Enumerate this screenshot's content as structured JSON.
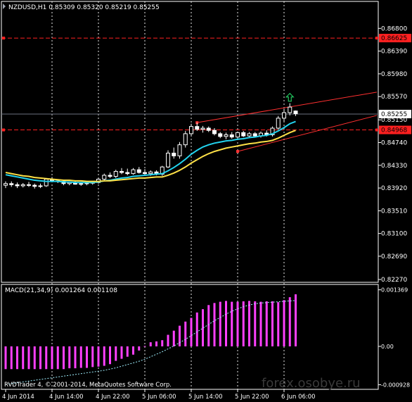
{
  "header": {
    "text": "NZDUSD,H1  0.85309 0.85320 0.85219 0.85255"
  },
  "macd_header": {
    "text": "MACD(21,34,9) 0.001264 0.001108"
  },
  "copyright": "RVDTrader 4, © 2001-2014, MetaQuotes Software Corp.",
  "watermark": "forex.osobye.ru",
  "colors": {
    "background": "#000000",
    "grid": "#ffffff",
    "axis": "#ffffff",
    "bull_candle": "#ffffff",
    "bear_candle": "#ffffff",
    "ma_fast": "#22d3ee",
    "ma_slow": "#fde047",
    "hline": "#ff2020",
    "channel": "#ff3030",
    "price_label_bg": "#ff2020",
    "current_label_bg": "#ffffff",
    "macd_hist": "#ff40ff",
    "macd_signal": "#a0f0ff",
    "arrow": "#22c55e"
  },
  "chart_data": [
    {
      "type": "line",
      "pane": "price",
      "title": "NZDUSD,H1",
      "ylim": [
        0.8227,
        0.8688
      ],
      "y_ticks": [
        "0.86800",
        "0.86390",
        "0.85980",
        "0.85570",
        "0.85150",
        "0.84740",
        "0.84330",
        "0.83920",
        "0.83510",
        "0.83100",
        "0.82690",
        "0.82270"
      ],
      "y_tick_values": [
        0.868,
        0.8639,
        0.8598,
        0.8557,
        0.8515,
        0.8474,
        0.8433,
        0.8392,
        0.8351,
        0.831,
        0.8269,
        0.8227
      ],
      "x_ticks": [
        "4 Jun 2014",
        "4 Jun 14:00",
        "4 Jun 22:00",
        "5 Jun 06:00",
        "5 Jun 14:00",
        "5 Jun 22:00",
        "6 Jun 06:00"
      ],
      "x_tick_bars": [
        0,
        8,
        16,
        24,
        32,
        40,
        48
      ],
      "candles": [
        {
          "o": 0.8397,
          "h": 0.8404,
          "l": 0.8392,
          "c": 0.84
        },
        {
          "o": 0.84,
          "h": 0.8404,
          "l": 0.8394,
          "c": 0.8398
        },
        {
          "o": 0.8398,
          "h": 0.8402,
          "l": 0.8392,
          "c": 0.8396
        },
        {
          "o": 0.8396,
          "h": 0.8401,
          "l": 0.8393,
          "c": 0.8398
        },
        {
          "o": 0.8398,
          "h": 0.8403,
          "l": 0.8394,
          "c": 0.8397
        },
        {
          "o": 0.8397,
          "h": 0.84,
          "l": 0.8391,
          "c": 0.8395
        },
        {
          "o": 0.8395,
          "h": 0.84,
          "l": 0.8392,
          "c": 0.8396
        },
        {
          "o": 0.8396,
          "h": 0.841,
          "l": 0.8394,
          "c": 0.8408
        },
        {
          "o": 0.8408,
          "h": 0.8412,
          "l": 0.8403,
          "c": 0.8405
        },
        {
          "o": 0.8405,
          "h": 0.8408,
          "l": 0.8401,
          "c": 0.8404
        },
        {
          "o": 0.8404,
          "h": 0.8407,
          "l": 0.8397,
          "c": 0.84
        },
        {
          "o": 0.84,
          "h": 0.8404,
          "l": 0.8397,
          "c": 0.8402
        },
        {
          "o": 0.8402,
          "h": 0.8405,
          "l": 0.8398,
          "c": 0.8399
        },
        {
          "o": 0.8399,
          "h": 0.8402,
          "l": 0.8396,
          "c": 0.84
        },
        {
          "o": 0.84,
          "h": 0.8403,
          "l": 0.8397,
          "c": 0.8401
        },
        {
          "o": 0.8401,
          "h": 0.8404,
          "l": 0.8398,
          "c": 0.8402
        },
        {
          "o": 0.8402,
          "h": 0.841,
          "l": 0.84,
          "c": 0.8408
        },
        {
          "o": 0.8408,
          "h": 0.8418,
          "l": 0.8405,
          "c": 0.8415
        },
        {
          "o": 0.8415,
          "h": 0.842,
          "l": 0.841,
          "c": 0.8413
        },
        {
          "o": 0.8413,
          "h": 0.8425,
          "l": 0.841,
          "c": 0.8422
        },
        {
          "o": 0.8422,
          "h": 0.8428,
          "l": 0.8417,
          "c": 0.842
        },
        {
          "o": 0.842,
          "h": 0.8427,
          "l": 0.8415,
          "c": 0.8418
        },
        {
          "o": 0.8418,
          "h": 0.8428,
          "l": 0.8416,
          "c": 0.8425
        },
        {
          "o": 0.8425,
          "h": 0.843,
          "l": 0.8418,
          "c": 0.842
        },
        {
          "o": 0.842,
          "h": 0.8426,
          "l": 0.8415,
          "c": 0.8418
        },
        {
          "o": 0.8418,
          "h": 0.8424,
          "l": 0.8414,
          "c": 0.8421
        },
        {
          "o": 0.8421,
          "h": 0.8424,
          "l": 0.8415,
          "c": 0.8417
        },
        {
          "o": 0.8417,
          "h": 0.8432,
          "l": 0.8414,
          "c": 0.843
        },
        {
          "o": 0.843,
          "h": 0.846,
          "l": 0.8428,
          "c": 0.8455
        },
        {
          "o": 0.8455,
          "h": 0.8465,
          "l": 0.8445,
          "c": 0.845
        },
        {
          "o": 0.845,
          "h": 0.8475,
          "l": 0.8445,
          "c": 0.847
        },
        {
          "o": 0.847,
          "h": 0.8495,
          "l": 0.8465,
          "c": 0.849
        },
        {
          "o": 0.849,
          "h": 0.8508,
          "l": 0.8485,
          "c": 0.8503
        },
        {
          "o": 0.8503,
          "h": 0.851,
          "l": 0.8495,
          "c": 0.8498
        },
        {
          "o": 0.8498,
          "h": 0.8504,
          "l": 0.8492,
          "c": 0.85
        },
        {
          "o": 0.85,
          "h": 0.8503,
          "l": 0.8493,
          "c": 0.8496
        },
        {
          "o": 0.8496,
          "h": 0.85,
          "l": 0.8487,
          "c": 0.849
        },
        {
          "o": 0.849,
          "h": 0.8493,
          "l": 0.8482,
          "c": 0.8485
        },
        {
          "o": 0.8485,
          "h": 0.8492,
          "l": 0.848,
          "c": 0.8488
        },
        {
          "o": 0.8488,
          "h": 0.8493,
          "l": 0.8481,
          "c": 0.8484
        },
        {
          "o": 0.8484,
          "h": 0.8494,
          "l": 0.8481,
          "c": 0.8492
        },
        {
          "o": 0.8492,
          "h": 0.8495,
          "l": 0.8484,
          "c": 0.8486
        },
        {
          "o": 0.8486,
          "h": 0.8493,
          "l": 0.8482,
          "c": 0.849
        },
        {
          "o": 0.849,
          "h": 0.8493,
          "l": 0.8483,
          "c": 0.8486
        },
        {
          "o": 0.8486,
          "h": 0.8494,
          "l": 0.8483,
          "c": 0.8491
        },
        {
          "o": 0.8491,
          "h": 0.8496,
          "l": 0.8485,
          "c": 0.8488
        },
        {
          "o": 0.8488,
          "h": 0.8503,
          "l": 0.8485,
          "c": 0.85
        },
        {
          "o": 0.85,
          "h": 0.8522,
          "l": 0.8497,
          "c": 0.8518
        },
        {
          "o": 0.8518,
          "h": 0.8535,
          "l": 0.8512,
          "c": 0.8528
        },
        {
          "o": 0.8528,
          "h": 0.8545,
          "l": 0.8523,
          "c": 0.8538
        },
        {
          "o": 0.8531,
          "h": 0.8532,
          "l": 0.8522,
          "c": 0.8526
        }
      ],
      "series": [
        {
          "values": [
            0.8416,
            0.8414,
            0.8412,
            0.841,
            0.8408,
            0.8406,
            0.8405,
            0.8404,
            0.8404,
            0.8404,
            0.8403,
            0.8403,
            0.8402,
            0.8402,
            0.8402,
            0.8402,
            0.8403,
            0.8405,
            0.8406,
            0.8408,
            0.841,
            0.8411,
            0.8413,
            0.8414,
            0.8415,
            0.8416,
            0.8417,
            0.8418,
            0.8423,
            0.8429,
            0.8436,
            0.8444,
            0.8453,
            0.846,
            0.8466,
            0.847,
            0.8473,
            0.8475,
            0.8477,
            0.8478,
            0.848,
            0.8481,
            0.8483,
            0.8484,
            0.8486,
            0.8487,
            0.849,
            0.8495,
            0.8501,
            0.8508,
            0.8512
          ]
        },
        {
          "values": [
            0.842,
            0.8418,
            0.8416,
            0.8414,
            0.8413,
            0.8411,
            0.841,
            0.8409,
            0.8408,
            0.8407,
            0.8406,
            0.8406,
            0.8405,
            0.8405,
            0.8404,
            0.8404,
            0.8404,
            0.8405,
            0.8405,
            0.8406,
            0.8407,
            0.8408,
            0.8409,
            0.841,
            0.841,
            0.8411,
            0.8412,
            0.8412,
            0.8415,
            0.8419,
            0.8424,
            0.843,
            0.8437,
            0.8443,
            0.8449,
            0.8454,
            0.8458,
            0.8461,
            0.8464,
            0.8466,
            0.8468,
            0.847,
            0.8472,
            0.8473,
            0.8475,
            0.8476,
            0.8478,
            0.8482,
            0.8487,
            0.8492,
            0.8496
          ]
        }
      ],
      "hlines": [
        {
          "value": 0.86625,
          "label": "0.86625"
        },
        {
          "value": 0.84968,
          "label": "0.84968"
        }
      ],
      "current_price": {
        "value": 0.85255,
        "label": "0.85255"
      },
      "channel": [
        {
          "from": [
            33,
            0.851
          ],
          "to": [
            64,
            0.8565
          ]
        },
        {
          "from": [
            40,
            0.8458
          ],
          "to": [
            64,
            0.8523
          ]
        }
      ],
      "signal_arrow": {
        "bar": 49,
        "value": 0.8555,
        "direction": "up"
      }
    },
    {
      "type": "bar",
      "pane": "macd",
      "title": "MACD(21,34,9)",
      "ylim": [
        -0.00092,
        0.00138
      ],
      "y_ticks": [
        "0.001369",
        "0.00",
        "-0.000928"
      ],
      "y_tick_values": [
        0.001369,
        0.0,
        -0.000928
      ],
      "series": [
        {
          "values": [
            -0.00055,
            -0.00055,
            -0.00055,
            -0.00055,
            -0.00055,
            -0.00055,
            -0.00055,
            -0.00055,
            -0.00055,
            -0.00055,
            -0.00055,
            -0.00053,
            -0.00053,
            -0.00052,
            -0.00052,
            -0.0005,
            -0.00049,
            -0.00047,
            -0.00043,
            -0.00035,
            -0.0003,
            -0.00025,
            -0.0002,
            -0.0001,
            1e-05,
            0.0001,
            0.00012,
            0.00015,
            0.00028,
            0.00038,
            0.0005,
            0.0006,
            0.00069,
            0.00082,
            0.0009,
            0.001,
            0.00105,
            0.00108,
            0.0011,
            0.00108,
            0.00108,
            0.00109,
            0.0011,
            0.00109,
            0.00108,
            0.00109,
            0.00109,
            0.00107,
            0.00112,
            0.00119,
            0.00126
          ]
        },
        {
          "values": [
            -0.00092,
            -0.0009,
            -0.00088,
            -0.00086,
            -0.00084,
            -0.00082,
            -0.0008,
            -0.00078,
            -0.00076,
            -0.00074,
            -0.00072,
            -0.0007,
            -0.00068,
            -0.00066,
            -0.00064,
            -0.00062,
            -0.0006,
            -0.00058,
            -0.00055,
            -0.00052,
            -0.00048,
            -0.00044,
            -0.0004,
            -0.00036,
            -0.00031,
            -0.00025,
            -0.00019,
            -0.00013,
            -6e-05,
            1e-05,
            9e-05,
            0.00017,
            0.00026,
            0.00035,
            0.00044,
            0.00053,
            0.00062,
            0.0007,
            0.00078,
            0.00085,
            0.00091,
            0.00096,
            0.001,
            0.00103,
            0.00105,
            0.00106,
            0.00107,
            0.00108,
            0.00109,
            0.0011,
            0.00111
          ]
        }
      ]
    }
  ]
}
